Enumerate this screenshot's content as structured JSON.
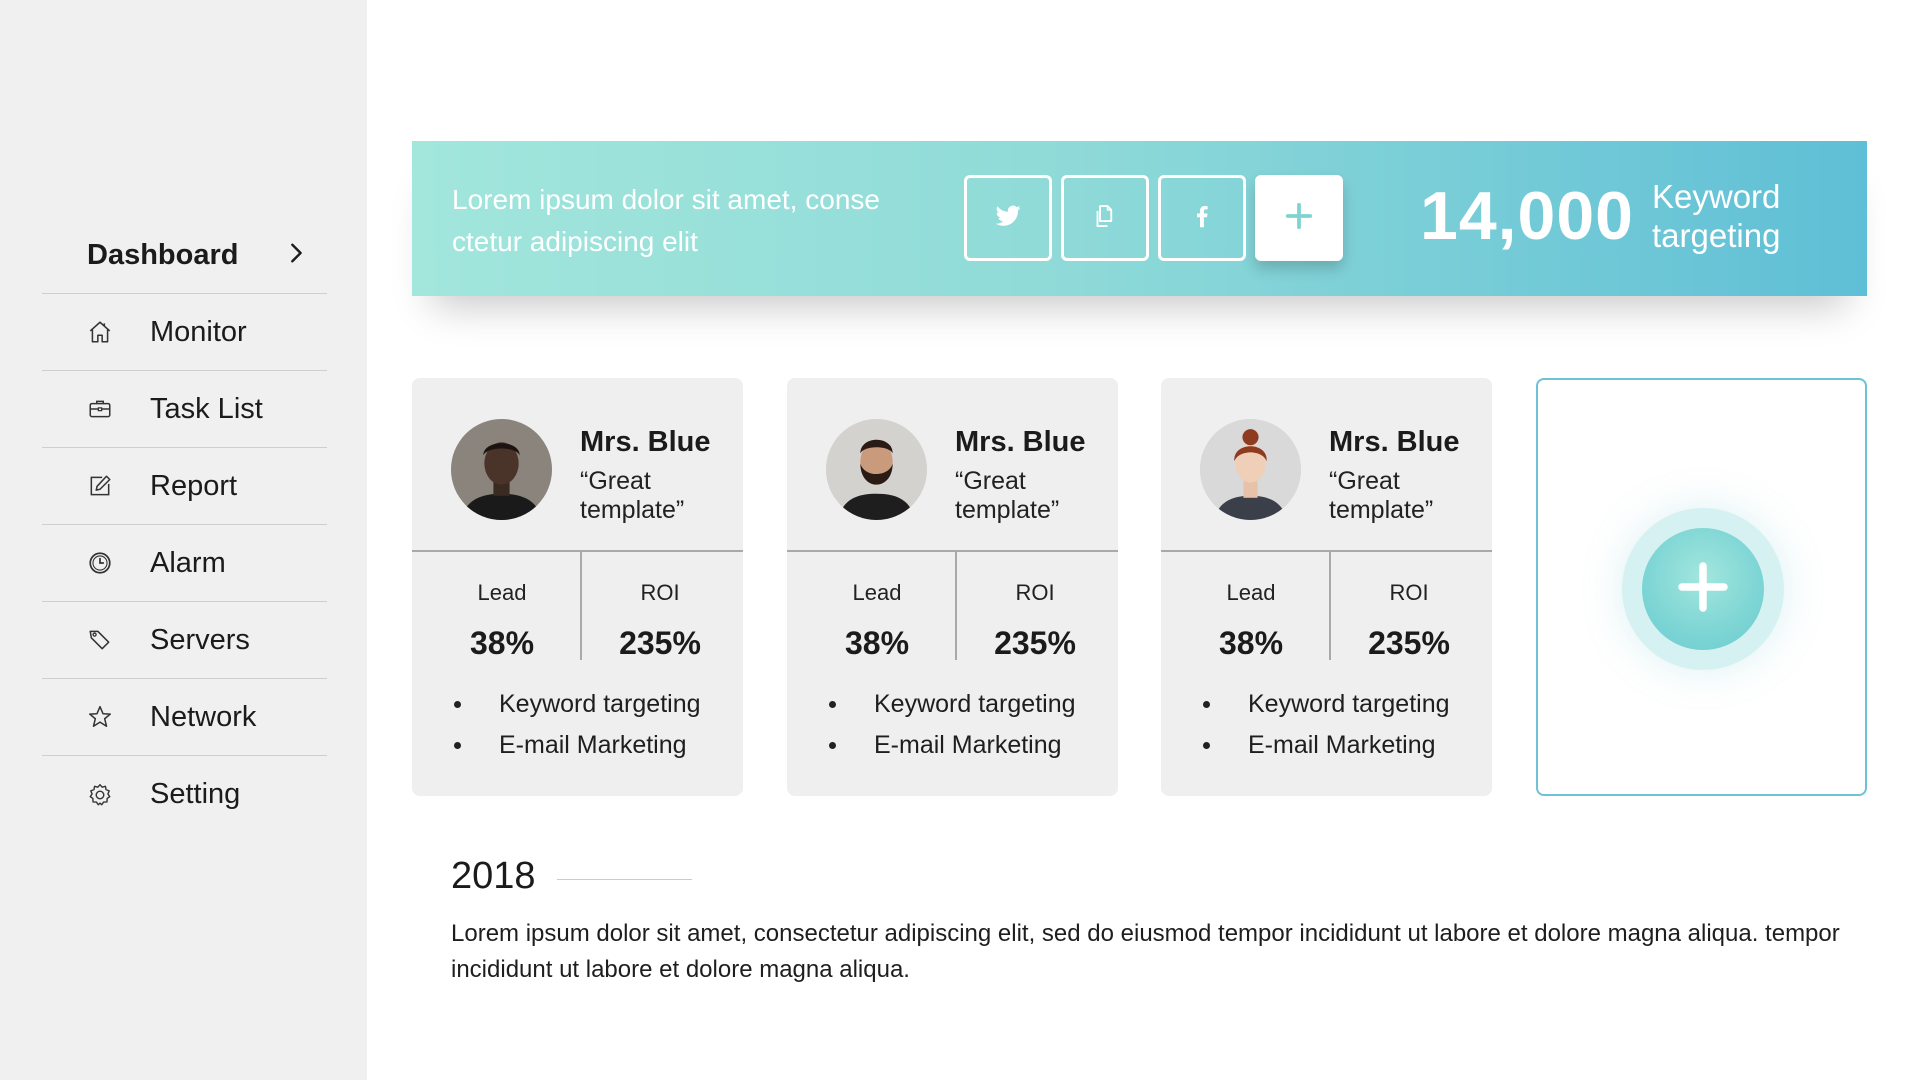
{
  "sidebar": {
    "header": {
      "label": "Dashboard",
      "icon": "chevron-right-icon"
    },
    "items": [
      {
        "label": "Monitor",
        "icon": "home-icon"
      },
      {
        "label": "Task List",
        "icon": "briefcase-icon"
      },
      {
        "label": "Report",
        "icon": "edit-icon"
      },
      {
        "label": "Alarm",
        "icon": "clock-icon"
      },
      {
        "label": "Servers",
        "icon": "tag-icon"
      },
      {
        "label": "Network",
        "icon": "star-icon"
      },
      {
        "label": "Setting",
        "icon": "gear-icon"
      }
    ]
  },
  "banner": {
    "text": "Lorem ipsum dolor sit amet, conse ctetur adipiscing elit",
    "buttons": [
      {
        "icon": "twitter-icon"
      },
      {
        "icon": "copy-icon"
      },
      {
        "icon": "facebook-icon"
      },
      {
        "icon": "plus-icon"
      }
    ],
    "stat_value": "14,000",
    "stat_label": "Keyword targeting",
    "gradient_start": "#a2e6dc",
    "gradient_end": "#5fbfd6"
  },
  "cards": [
    {
      "name": "Mrs. Blue",
      "quote": "“Great template”",
      "metrics": [
        {
          "label": "Lead",
          "value": "38%"
        },
        {
          "label": "ROI",
          "value": "235%"
        }
      ],
      "bullets": [
        "Keyword targeting",
        "E-mail Marketing"
      ]
    },
    {
      "name": "Mrs. Blue",
      "quote": "“Great template”",
      "metrics": [
        {
          "label": "Lead",
          "value": "38%"
        },
        {
          "label": "ROI",
          "value": "235%"
        }
      ],
      "bullets": [
        "Keyword targeting",
        "E-mail Marketing"
      ]
    },
    {
      "name": "Mrs. Blue",
      "quote": "“Great template”",
      "metrics": [
        {
          "label": "Lead",
          "value": "38%"
        },
        {
          "label": "ROI",
          "value": "235%"
        }
      ],
      "bullets": [
        "Keyword targeting",
        "E-mail Marketing"
      ]
    }
  ],
  "add_card": {
    "icon": "plus-icon",
    "accent": "#6ec2d6"
  },
  "section": {
    "year": "2018",
    "paragraph": "Lorem ipsum dolor sit amet, consectetur adipiscing elit, sed do eiusmod tempor incididunt ut labore et dolore magna aliqua. tempor incididunt ut labore et dolore magna aliqua."
  }
}
